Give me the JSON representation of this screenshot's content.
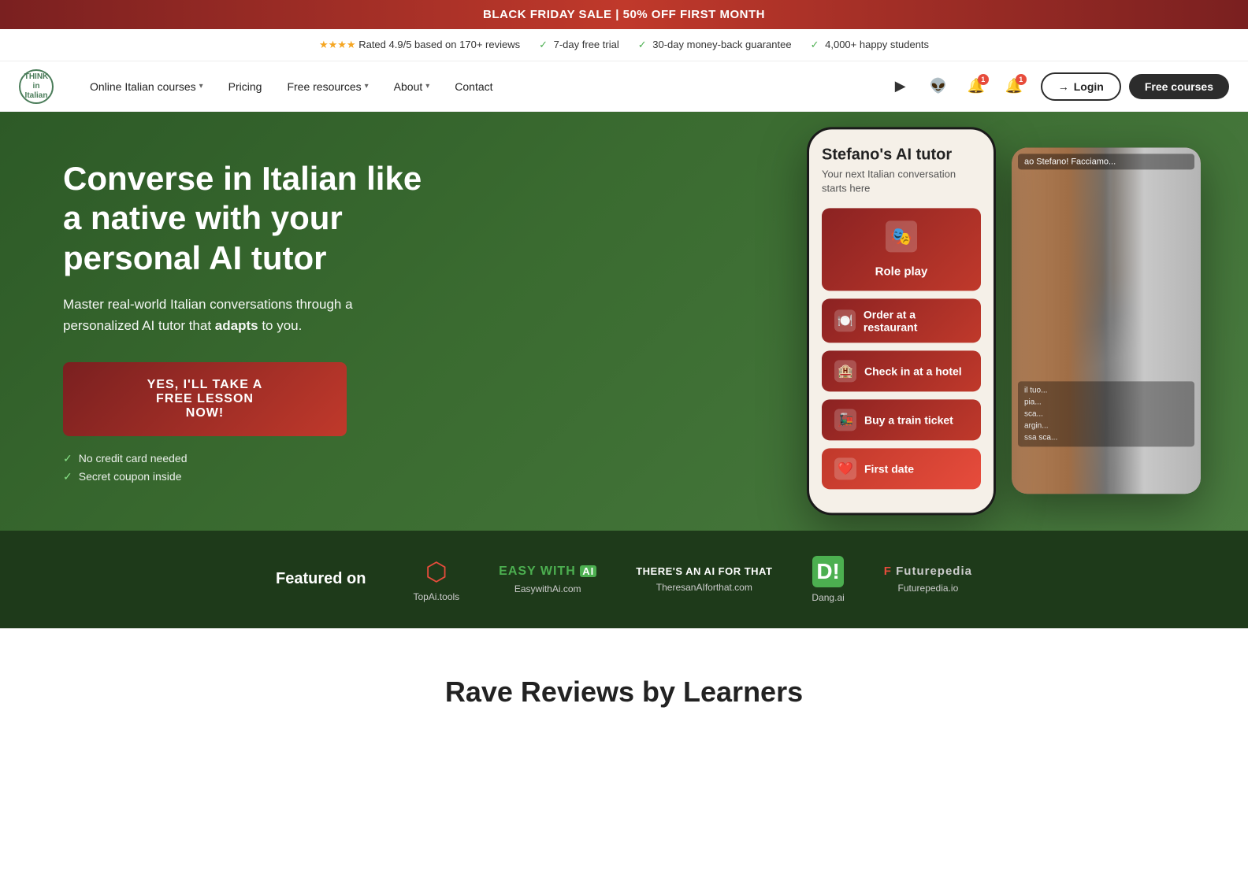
{
  "banner": {
    "text": "BLACK FRIDAY SALE | 50% OFF FIRST MONTH"
  },
  "trust_bar": {
    "stars": "★★★★",
    "rating": "Rated 4.9/5 based on 170+ reviews",
    "items": [
      "7-day free trial",
      "30-day money-back guarantee",
      "4,000+ happy students"
    ]
  },
  "navbar": {
    "logo_text": "THINK\nin Italian",
    "nav_items": [
      {
        "label": "Online Italian courses",
        "has_dropdown": true
      },
      {
        "label": "Pricing",
        "has_dropdown": false
      },
      {
        "label": "Free resources",
        "has_dropdown": true
      },
      {
        "label": "About",
        "has_dropdown": true
      },
      {
        "label": "Contact",
        "has_dropdown": false
      }
    ],
    "login_label": "Login",
    "free_courses_label": "Free courses"
  },
  "hero": {
    "title": "Converse in Italian like a native with your personal AI tutor",
    "subtitle_part1": "Master real-world Italian conversations through a personalized AI tutor that ",
    "subtitle_bold": "adapts",
    "subtitle_part2": " to you.",
    "cta_button": "YES, I'LL TAKE A\nFREE LESSON\nNOW!",
    "checks": [
      "No credit card needed",
      "Secret coupon inside"
    ]
  },
  "phone_mockup": {
    "title": "Stefano's AI tutor",
    "subtitle": "Your next Italian conversation starts here",
    "buttons": [
      {
        "icon": "🎭",
        "label": "Role play",
        "style": "large"
      },
      {
        "icon": "🍽️",
        "label": "Order at a restaurant",
        "style": "normal"
      },
      {
        "icon": "🏨",
        "label": "Check in at a hotel",
        "style": "normal"
      },
      {
        "icon": "🚂",
        "label": "Buy a train ticket",
        "style": "normal"
      },
      {
        "icon": "❤️",
        "label": "First date",
        "style": "normal"
      }
    ]
  },
  "featured": {
    "label": "Featured on",
    "logos": [
      {
        "icon": "⬡",
        "name": "TopAi.tools",
        "style": "icon"
      },
      {
        "text": "EASY WITH AI",
        "suffix": "",
        "name": "EasywithAi.com",
        "style": "text"
      },
      {
        "text": "THERE'S AN AI FOR THAT",
        "name": "TheresanAIforthat.com",
        "style": "text-small"
      },
      {
        "icon": "D!",
        "name": "Dang.ai",
        "style": "badge"
      },
      {
        "text": "F Futurepedia",
        "name": "Futurepedia.io",
        "style": "text"
      }
    ]
  },
  "reviews": {
    "title_part1": "Rave Reviews by Learners"
  },
  "colors": {
    "dark_green": "#2d5a27",
    "mid_green": "#3a6b30",
    "dark_red": "#7a2020",
    "bright_red": "#c0392b",
    "near_black": "#2c2c2c"
  }
}
